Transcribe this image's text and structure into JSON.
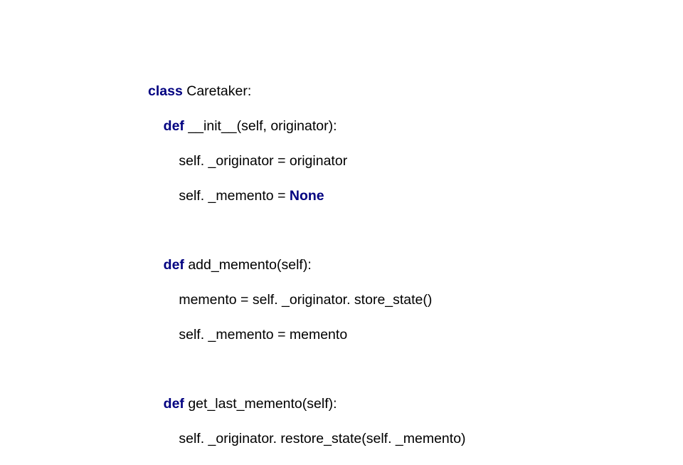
{
  "code": {
    "kw_class": "class",
    "l1_rest": " Caretaker:",
    "kw_def1": "def",
    "l2_rest": " __init__(self, originator):",
    "l3": "self. _originator = originator",
    "l4_pre": "self. _memento = ",
    "kw_none": "None",
    "kw_def2": "def",
    "l6_rest": " add_memento(self):",
    "l7": "memento = self. _originator. store_state()",
    "l8": "self. _memento = memento",
    "kw_def3": "def",
    "l10_rest": " get_last_memento(self):",
    "l11": "self. _originator. restore_state(self. _memento)"
  }
}
